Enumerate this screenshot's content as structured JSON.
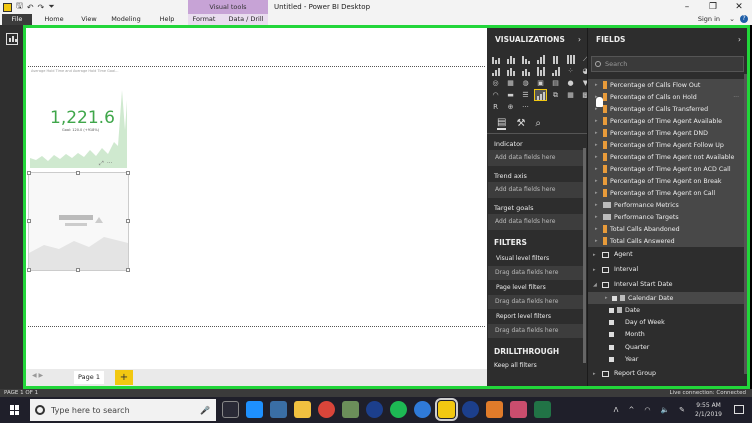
{
  "window": {
    "title": "Untitled - Power BI Desktop",
    "contextual_tab_group": "Visual tools"
  },
  "ribbon": {
    "tabs": [
      "File",
      "Home",
      "View",
      "Modeling",
      "Help",
      "Format",
      "Data / Drill"
    ],
    "sign_in": "Sign in"
  },
  "canvas": {
    "visual1_title": "Average Hold Time and Average Hold Time Goal...",
    "kpi_value": "1,221.6",
    "kpi_goal": "Goal: 120.0 (+918%)",
    "page_tab": "Page 1",
    "add_page": "+"
  },
  "visualizations": {
    "header": "VISUALIZATIONS",
    "wells": [
      {
        "label": "Indicator",
        "drop": "Add data fields here"
      },
      {
        "label": "Trend axis",
        "drop": "Add data fields here"
      },
      {
        "label": "Target goals",
        "drop": "Add data fields here"
      }
    ],
    "filters_header": "FILTERS",
    "filters": [
      {
        "label": "Visual level filters",
        "drop": "Drag data fields here"
      },
      {
        "label": "Page level filters",
        "drop": "Drag data fields here"
      },
      {
        "label": "Report level filters",
        "drop": "Drag data fields here"
      }
    ],
    "drill_header": "DRILLTHROUGH",
    "keep_all_filters": "Keep all filters"
  },
  "fields": {
    "header": "FIELDS",
    "search_placeholder": "Search",
    "measures": [
      "Percentage of Calls Flow Out",
      "Percentage of Calls on Hold",
      "Percentage of Calls Transferred",
      "Percentage of Time Agent Available",
      "Percentage of Time Agent DND",
      "Percentage of Time Agent Follow Up",
      "Percentage of Time Agent not Available",
      "Percentage of Time Agent on ACD Call",
      "Percentage of Time Agent on Break",
      "Percentage of Time Agent on Call"
    ],
    "folders": [
      "Performance Metrics",
      "Performance Targets"
    ],
    "totals": [
      "Total Calls Abandoned",
      "Total Calls Answered"
    ],
    "tables": [
      "Agent",
      "Interval",
      "Interval Start Date"
    ],
    "hierarchy": "Calendar Date",
    "date_field": "Date",
    "date_parts": [
      "Day of Week",
      "Month",
      "Quarter",
      "Year"
    ],
    "last_table": "Report Group"
  },
  "statusbar": {
    "page": "PAGE 1 OF 1",
    "connection": "Live connection: Connected"
  },
  "taskbar": {
    "search_placeholder": "Type here to search",
    "time": "9:55 AM",
    "date": "2/1/2019"
  },
  "colors": {
    "accent_green": "#22d63a",
    "kpi_green": "#3fa64a",
    "powerbi_yellow": "#f2c811"
  }
}
